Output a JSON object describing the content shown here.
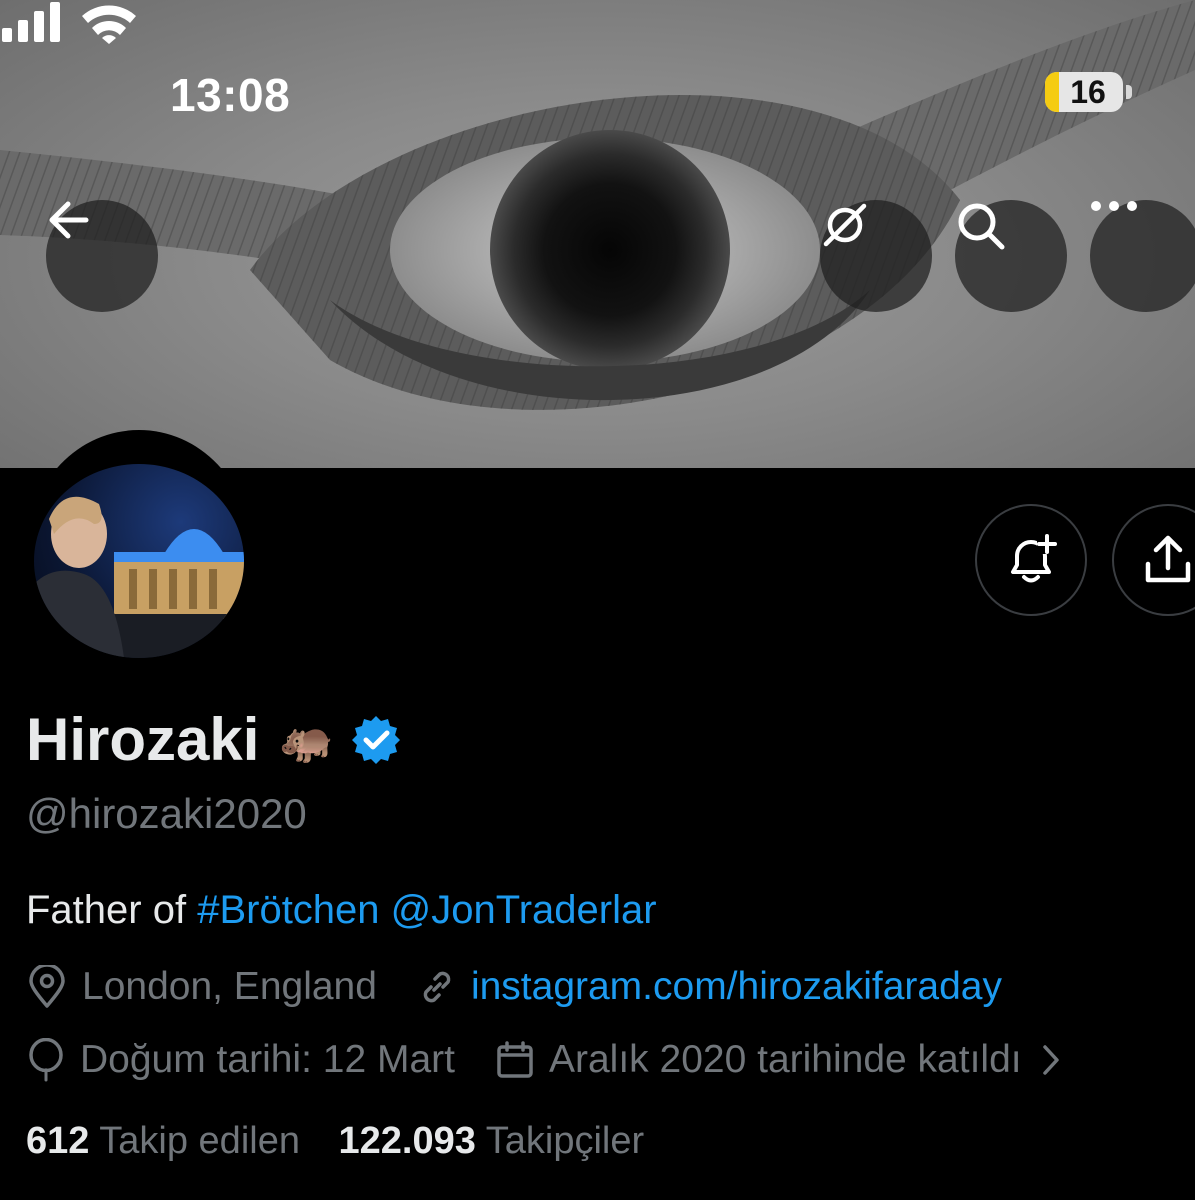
{
  "status_bar": {
    "time": "13:08",
    "battery": "16",
    "icons": [
      "signal-icon",
      "wifi-icon",
      "battery-icon"
    ]
  },
  "nav": {
    "back_icon": "back-arrow-icon",
    "grok_icon": "grok-icon",
    "search_icon": "search-icon",
    "more_icon": "more-icon"
  },
  "actions": {
    "notify_icon": "bell-plus-icon",
    "share_icon": "share-icon"
  },
  "profile": {
    "name": "Hirozaki",
    "emoji": "🦛",
    "verified_color": "#1d9bf0",
    "handle": "@hirozaki2020",
    "bio_prefix": "Father of ",
    "bio_hashtag": "#Brötchen",
    "bio_mention": "@JonTraderlar",
    "location": "London, England",
    "website": "instagram.com/hirozakifaraday",
    "birthday": "Doğum tarihi: 12 Mart",
    "joined": "Aralık 2020 tarihinde katıldı",
    "following_count": "612",
    "following_label": "Takip edilen",
    "followers_count": "122.093",
    "followers_label": "Takipçiler"
  },
  "colors": {
    "accent": "#1d9bf0",
    "muted": "#71767b",
    "text": "#e7e9ea",
    "battery_low": "#f5cc12"
  }
}
